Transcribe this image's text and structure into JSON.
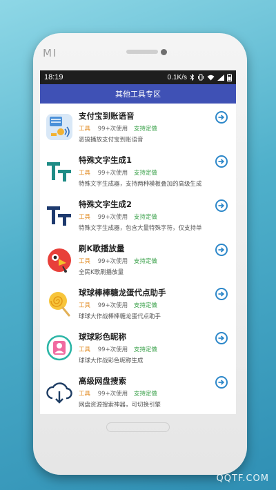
{
  "device": {
    "brand": "MI"
  },
  "status_bar": {
    "time": "18:19",
    "net_speed": "0.1K/s",
    "icons": [
      "bluetooth-icon",
      "vibrate-icon",
      "wifi-icon",
      "signal-icon",
      "battery-icon"
    ]
  },
  "app_bar": {
    "title": "其他工具专区"
  },
  "tools": [
    {
      "name": "支付宝到账语音",
      "tag": "工具",
      "usage": "99+次使用",
      "custom": "支持定做",
      "desc": "恶搞播放支付宝到账语音",
      "icon": "alipay-voice-icon"
    },
    {
      "name": "特殊文字生成1",
      "tag": "工具",
      "usage": "99+次使用",
      "custom": "支持定做",
      "desc": "特殊文字生成器，支持两种模板叠加的高级生成",
      "icon": "tt-text-icon"
    },
    {
      "name": "特殊文字生成2",
      "tag": "工具",
      "usage": "99+次使用",
      "custom": "支持定做",
      "desc": "特殊文字生成器，包含大量特殊字符，仅支持单",
      "icon": "tt-text-icon"
    },
    {
      "name": "刷K歌播放量",
      "tag": "工具",
      "usage": "99+次使用",
      "custom": "支持定做",
      "desc": "全民K歌刷播放量",
      "icon": "karaoke-bird-icon"
    },
    {
      "name": "球球棒棒糖龙蛋代点助手",
      "tag": "工具",
      "usage": "99+次使用",
      "custom": "支持定做",
      "desc": "球球大作战棒棒糖龙蛋代点助手",
      "icon": "lollipop-icon"
    },
    {
      "name": "球球彩色昵称",
      "tag": "工具",
      "usage": "99+次使用",
      "custom": "支持定做",
      "desc": "球球大作战彩色昵称生成",
      "icon": "colored-nickname-icon"
    },
    {
      "name": "高级网盘搜索",
      "tag": "工具",
      "usage": "99+次使用",
      "custom": "支持定做",
      "desc": "网盘资源搜索神器，可切换引擎",
      "icon": "cloud-download-icon"
    }
  ],
  "watermark": "QQTF.COM",
  "colors": {
    "app_bar": "#3f51b5",
    "tag": "#e28a1f",
    "custom": "#3aa14a",
    "go_button": "#2c87c9"
  }
}
